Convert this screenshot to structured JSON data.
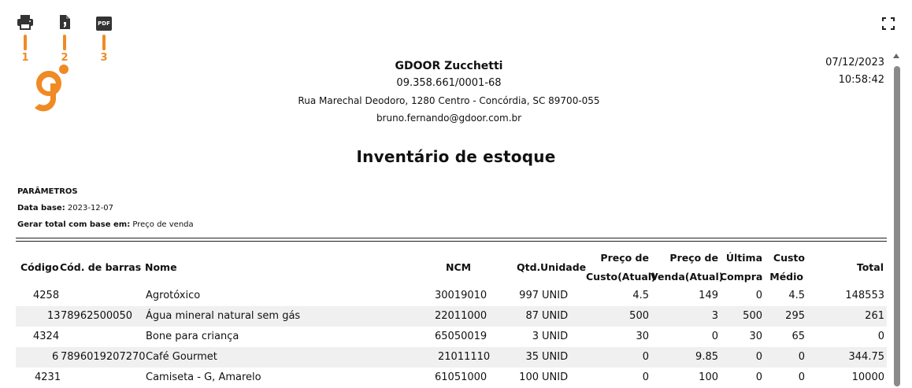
{
  "toolbar": {
    "items": [
      {
        "icon": "printer-icon",
        "number": "1"
      },
      {
        "icon": "document-icon",
        "number": "2"
      },
      {
        "icon": "pdf-icon",
        "label": "PDF",
        "number": "3"
      }
    ],
    "accent": "#f08a24",
    "fullscreen_icon": "fullscreen-icon"
  },
  "logo": {
    "name": "gdoor-logo",
    "color": "#f08a24"
  },
  "company": {
    "name": "GDOOR Zucchetti",
    "cnpj": "09.358.661/0001-68",
    "address": "Rua Marechal Deodoro, 1280 Centro - Concórdia, SC 89700-055",
    "email": "bruno.fernando@gdoor.com.br"
  },
  "report": {
    "date": "07/12/2023",
    "time": "10:58:42",
    "title": "Inventário de estoque"
  },
  "params": {
    "heading": "PARÂMETROS",
    "date_label": "Data base:",
    "date_value": "2023-12-07",
    "total_label": "Gerar total com base em:",
    "total_value": "Preço de venda"
  },
  "table": {
    "headers": {
      "code": "Código",
      "barcode": "Cód. de barras",
      "name": "Nome",
      "ncm": "NCM",
      "qty": "Qtd.",
      "unit": "Unidade",
      "cost_price_1": "Preço de",
      "cost_price_2": "Custo(Atual)",
      "sale_price_1": "Preço de",
      "sale_price_2": "Venda(Atual)",
      "last_purchase_1": "Última",
      "last_purchase_2": "Compra",
      "avg_cost_1": "Custo",
      "avg_cost_2": "Médio",
      "total": "Total"
    },
    "rows": [
      {
        "code": "4258",
        "barcode": "",
        "name": "Agrotóxico",
        "ncm": "30019010",
        "qty": "997",
        "unit": "UNID",
        "cost": "4.5",
        "sale": "149",
        "last": "0",
        "avg": "4.5",
        "total": "148553"
      },
      {
        "code": "13",
        "barcode": "78962500050",
        "name": "Água mineral natural sem gás",
        "ncm": "22011000",
        "qty": "87",
        "unit": "UNID",
        "cost": "500",
        "sale": "3",
        "last": "500",
        "avg": "295",
        "total": "261"
      },
      {
        "code": "4324",
        "barcode": "",
        "name": "Bone para criança",
        "ncm": "65050019",
        "qty": "3",
        "unit": "UNID",
        "cost": "30",
        "sale": "0",
        "last": "30",
        "avg": "65",
        "total": "0"
      },
      {
        "code": "6",
        "barcode": "7896019207270",
        "name": "Café Gourmet",
        "ncm": "21011110",
        "qty": "35",
        "unit": "UNID",
        "cost": "0",
        "sale": "9.85",
        "last": "0",
        "avg": "0",
        "total": "344.75"
      },
      {
        "code": "4231",
        "barcode": "",
        "name": "Camiseta - G, Amarelo",
        "ncm": "61051000",
        "qty": "100",
        "unit": "UNID",
        "cost": "0",
        "sale": "100",
        "last": "0",
        "avg": "0",
        "total": "10000"
      }
    ]
  }
}
